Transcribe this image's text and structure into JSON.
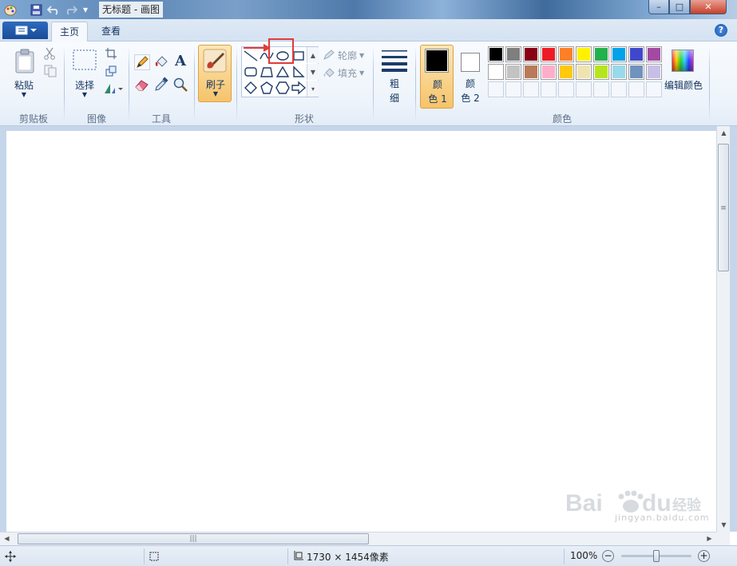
{
  "window": {
    "title": "无标题 - 画图",
    "minimize": "–",
    "maximize": "□",
    "close": "✕"
  },
  "quick_access": {
    "dropdown_glyph": "▾"
  },
  "tabs": [
    {
      "label": "主页",
      "active": true
    },
    {
      "label": "查看",
      "active": false
    }
  ],
  "help_glyph": "?",
  "ribbon": {
    "clipboard": {
      "paste_label": "粘贴",
      "group_label": "剪贴板"
    },
    "image": {
      "select_label": "选择",
      "group_label": "图像"
    },
    "tools": {
      "group_label": "工具",
      "text_glyph": "A"
    },
    "brushes": {
      "label": "刷子"
    },
    "shapes": {
      "outline_label": "轮廓",
      "fill_label": "填充",
      "group_label": "形状",
      "selected_shape": "oval"
    },
    "size": {
      "label_line1": "粗",
      "label_line2": "细"
    },
    "colors": {
      "color1_line1": "颜",
      "color1_line2": "色 1",
      "color2_line1": "颜",
      "color2_line2": "色 2",
      "color1_value": "#000000",
      "color2_value": "#ffffff",
      "edit_colors_label": "编辑颜色",
      "group_label": "颜色",
      "palette_row1": [
        "#000000",
        "#7f7f7f",
        "#880015",
        "#ed1c24",
        "#ff7f27",
        "#fff200",
        "#22b14c",
        "#00a2e8",
        "#3f48cc",
        "#a349a4"
      ],
      "palette_row2": [
        "#ffffff",
        "#c3c3c3",
        "#b97a57",
        "#ffaec9",
        "#ffc90e",
        "#efe4b0",
        "#b5e61d",
        "#99d9ea",
        "#7092be",
        "#c8bfe7"
      ]
    }
  },
  "statusbar": {
    "canvas_size": "1730 × 1454像素",
    "zoom": "100%",
    "zoom_out": "−",
    "zoom_in": "+"
  },
  "watermark": {
    "text": "jingyan.baidu.com"
  },
  "accent": {
    "highlight_red": "#e03a3a",
    "active_orange": "#f6c36a"
  }
}
